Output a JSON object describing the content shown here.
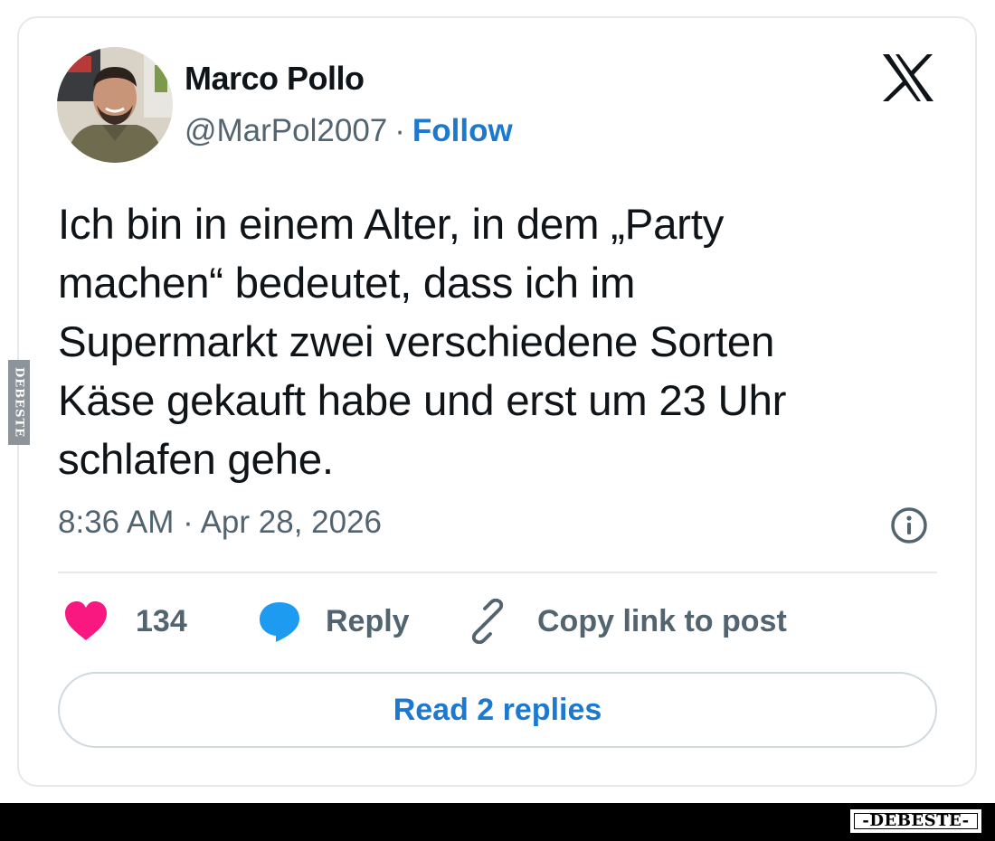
{
  "author": {
    "name": "Marco Pollo",
    "handle": "@MarPol2007",
    "separator": "·",
    "follow_label": "Follow"
  },
  "brand_icon": "x-logo-icon",
  "tweet": {
    "text": "Ich bin in einem Alter, in dem „Party\nmachen“ bedeutet, dass ich im\nSupermarkt zwei verschiedene Sorten\nKäse gekauft habe und erst um 23 Uhr\nschlafen gehe.",
    "timestamp": "8:36 AM · Apr 28, 2026"
  },
  "actions": {
    "like_count": "134",
    "reply_label": "Reply",
    "copy_label": "Copy link to post"
  },
  "read_replies_label": "Read 2 replies",
  "watermark": {
    "side": "DEBESTE",
    "footer": "-DEBESTE-"
  },
  "colors": {
    "link_blue": "#1d78cf",
    "heart_pink": "#f91880",
    "reply_blue": "#1d9bf0",
    "muted_gray": "#536471",
    "border": "#e6e9eb"
  }
}
